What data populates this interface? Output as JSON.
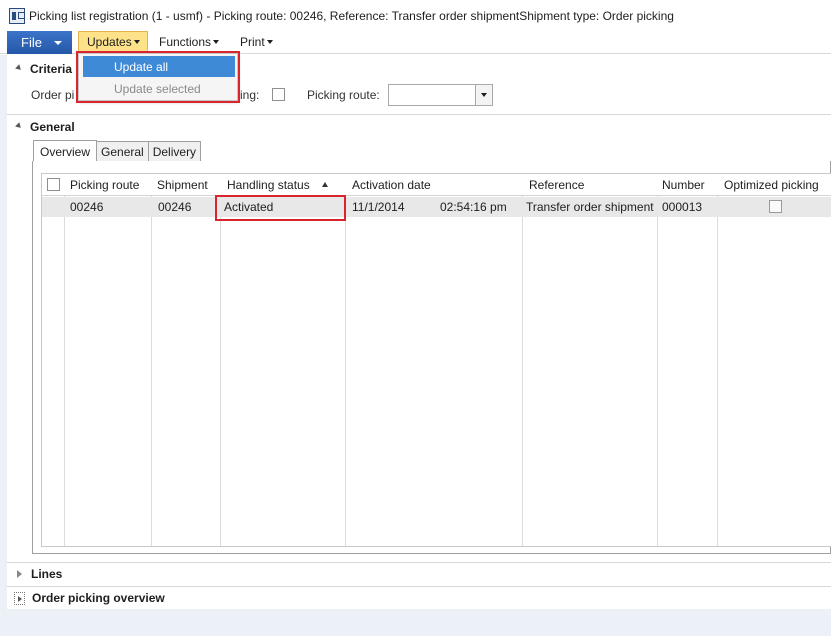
{
  "window": {
    "title": "Picking list registration (1 - usmf) - Picking route: 00246, Reference: Transfer order shipmentShipment type: Order picking"
  },
  "menubar": {
    "file_label": "File",
    "updates_label": "Updates",
    "functions_label": "Functions",
    "print_label": "Print"
  },
  "updates_menu": {
    "items": [
      {
        "label": "Update all",
        "state": "highlighted"
      },
      {
        "label": "Update selected",
        "state": "disabled"
      }
    ]
  },
  "criteria": {
    "header": "Criteria",
    "order_picking_label": "Order pi",
    "picking_label": "king:",
    "picking_route_label": "Picking route:",
    "picking_route_value": ""
  },
  "general": {
    "header": "General",
    "tabs": [
      {
        "label": "Overview",
        "active": true
      },
      {
        "label": "General",
        "active": false
      },
      {
        "label": "Delivery",
        "active": false
      }
    ],
    "grid": {
      "columns": [
        "Picking route",
        "Shipment",
        "Handling status",
        "Activation date",
        "Reference",
        "Number",
        "Optimized picking"
      ],
      "sort_column": "Handling status",
      "sort_direction": "ascending",
      "rows": [
        {
          "picking_route": "00246",
          "shipment": "00246",
          "handling_status": "Activated",
          "activation_date": "11/1/2014",
          "activation_time": "02:54:16 pm",
          "reference": "Transfer order shipment",
          "number": "000013",
          "optimized_picking": false
        }
      ]
    }
  },
  "lines": {
    "header": "Lines"
  },
  "order_picking_overview": {
    "header": "Order picking overview"
  },
  "colors": {
    "file_button": "#2f66b8",
    "updates_highlight": "#fde28a",
    "menu_selection": "#3f8ad6",
    "callout_red": "#d9262e",
    "selected_row": "#e8e8e8"
  }
}
